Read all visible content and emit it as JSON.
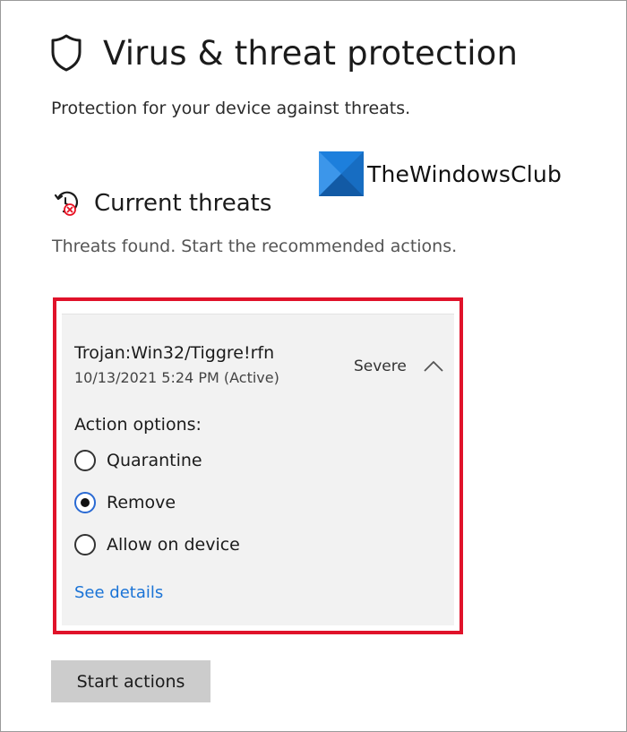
{
  "page": {
    "title": "Virus & threat protection",
    "subtitle": "Protection for your device against threats."
  },
  "watermark": {
    "text": "TheWindowsClub"
  },
  "current_threats": {
    "title": "Current threats",
    "description": "Threats found. Start the recommended actions.",
    "threat": {
      "name": "Trojan:Win32/Tiggre!rfn",
      "date": "10/13/2021 5:24 PM (Active)",
      "severity": "Severe",
      "action_options_label": "Action options:",
      "options": [
        {
          "label": "Quarantine",
          "selected": false
        },
        {
          "label": "Remove",
          "selected": true
        },
        {
          "label": "Allow on device",
          "selected": false
        }
      ],
      "see_details": "See details"
    }
  },
  "buttons": {
    "start_actions": "Start actions"
  },
  "icons": {
    "page": "shield-icon",
    "section": "clock-alert-icon",
    "collapse": "chevron-up-icon",
    "watermark_logo": "windows-logo-icon"
  },
  "colors": {
    "highlight_border": "#e0122a",
    "link": "#1a73d6",
    "logo_blue": "#1d7fdc",
    "alert_red": "#e81123"
  }
}
